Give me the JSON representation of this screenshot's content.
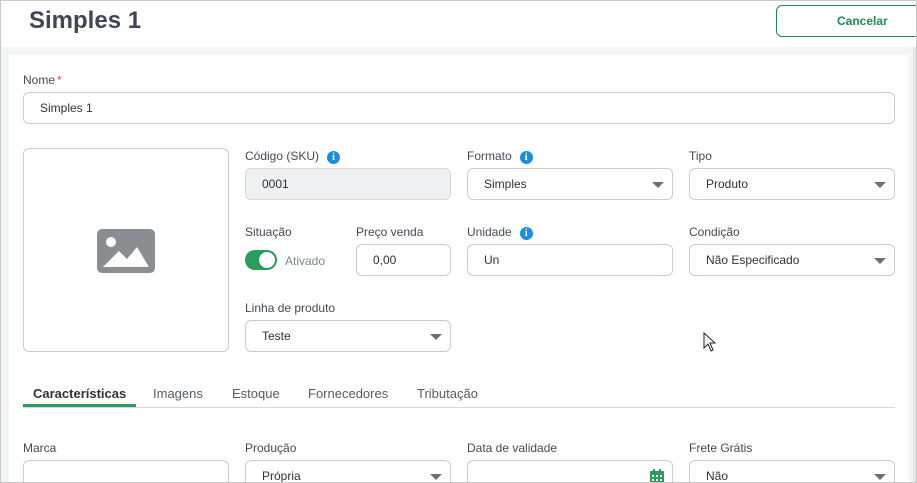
{
  "header": {
    "title": "Simples 1",
    "cancel_label": "Cancelar"
  },
  "form": {
    "nome": {
      "label": "Nome",
      "required_mark": "*",
      "value": "Simples 1"
    },
    "sku": {
      "label": "Código (SKU)",
      "value": "0001",
      "info_icon": "info-icon"
    },
    "formato": {
      "label": "Formato",
      "value": "Simples",
      "info_icon": "info-icon"
    },
    "tipo": {
      "label": "Tipo",
      "value": "Produto"
    },
    "situacao": {
      "label": "Situação",
      "toggle_text": "Ativado",
      "enabled": true
    },
    "preco_venda": {
      "label": "Preço venda",
      "value": "0,00"
    },
    "unidade": {
      "label": "Unidade",
      "value": "Un",
      "info_icon": "info-icon"
    },
    "condicao": {
      "label": "Condição",
      "value": "Não Especificado"
    },
    "linha_produto": {
      "label": "Linha de produto",
      "value": "Teste"
    }
  },
  "tabs": [
    {
      "label": "Características",
      "active": true
    },
    {
      "label": "Imagens",
      "active": false
    },
    {
      "label": "Estoque",
      "active": false
    },
    {
      "label": "Fornecedores",
      "active": false
    },
    {
      "label": "Tributação",
      "active": false
    }
  ],
  "caracteristicas": {
    "marca": {
      "label": "Marca",
      "value": ""
    },
    "producao": {
      "label": "Produção",
      "value": "Própria"
    },
    "data_validade": {
      "label": "Data de validade",
      "value": "",
      "icon": "calendar-icon"
    },
    "frete_gratis": {
      "label": "Frete Grátis",
      "value": "Não"
    }
  },
  "colors": {
    "accent": "#2a9d5c",
    "info": "#1d8fd6",
    "required": "#d9534f"
  }
}
